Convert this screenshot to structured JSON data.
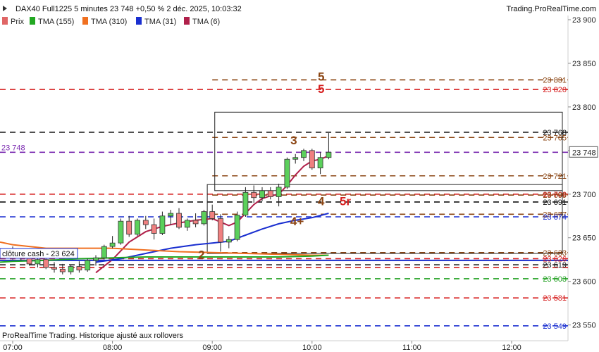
{
  "header": {
    "title": "DAX40 Full1225 5 minutes 23 748 +0,50 % 2 déc. 2025, 10:03:32",
    "brand": "Trading.ProRealTime.com"
  },
  "legend": [
    {
      "label": "Prix",
      "color": "#e06666"
    },
    {
      "label": "TMA (155)",
      "color": "#22a822"
    },
    {
      "label": "TMA (310)",
      "color": "#f07020"
    },
    {
      "label": "TMA (31)",
      "color": "#1a2fd0"
    },
    {
      "label": "TMA (6)",
      "color": "#b0204a"
    }
  ],
  "footer_note": "ProRealTime Trading. Historique ajusté aux rollovers",
  "cash_close_label": "clôture cash -  23 624",
  "current_price_label": "23 748",
  "current_price_left": "23 748",
  "chart_data": {
    "type": "candlestick",
    "ylim": [
      23540,
      23900
    ],
    "yticks": [
      "23 550",
      "23 600",
      "23 650",
      "23 700",
      "23 750",
      "23 800",
      "23 850",
      "23 900"
    ],
    "yticks_values": [
      23550,
      23600,
      23650,
      23700,
      23750,
      23800,
      23850,
      23900
    ],
    "xticks": [
      "07:00",
      "08:00",
      "09:00",
      "10:00",
      "11:00",
      "12:00"
    ],
    "candles": [
      {
        "t": "07:00",
        "o": 23630,
        "h": 23640,
        "l": 23625,
        "c": 23632
      },
      {
        "t": "07:05",
        "o": 23632,
        "h": 23635,
        "l": 23624,
        "c": 23627
      },
      {
        "t": "07:10",
        "o": 23627,
        "h": 23632,
        "l": 23618,
        "c": 23620
      },
      {
        "t": "07:15",
        "o": 23620,
        "h": 23628,
        "l": 23616,
        "c": 23625
      },
      {
        "t": "07:20",
        "o": 23625,
        "h": 23628,
        "l": 23614,
        "c": 23616
      },
      {
        "t": "07:25",
        "o": 23616,
        "h": 23622,
        "l": 23610,
        "c": 23614
      },
      {
        "t": "07:30",
        "o": 23614,
        "h": 23620,
        "l": 23608,
        "c": 23611
      },
      {
        "t": "07:35",
        "o": 23611,
        "h": 23619,
        "l": 23608,
        "c": 23617
      },
      {
        "t": "07:40",
        "o": 23617,
        "h": 23623,
        "l": 23610,
        "c": 23613
      },
      {
        "t": "07:45",
        "o": 23613,
        "h": 23626,
        "l": 23611,
        "c": 23624
      },
      {
        "t": "07:50",
        "o": 23624,
        "h": 23630,
        "l": 23618,
        "c": 23627
      },
      {
        "t": "07:55",
        "o": 23627,
        "h": 23642,
        "l": 23625,
        "c": 23640
      },
      {
        "t": "08:00",
        "o": 23640,
        "h": 23652,
        "l": 23638,
        "c": 23644
      },
      {
        "t": "08:05",
        "o": 23644,
        "h": 23672,
        "l": 23642,
        "c": 23669
      },
      {
        "t": "08:10",
        "o": 23669,
        "h": 23675,
        "l": 23651,
        "c": 23654
      },
      {
        "t": "08:15",
        "o": 23654,
        "h": 23672,
        "l": 23652,
        "c": 23670
      },
      {
        "t": "08:20",
        "o": 23670,
        "h": 23675,
        "l": 23660,
        "c": 23665
      },
      {
        "t": "08:25",
        "o": 23665,
        "h": 23672,
        "l": 23648,
        "c": 23655
      },
      {
        "t": "08:30",
        "o": 23655,
        "h": 23680,
        "l": 23653,
        "c": 23675
      },
      {
        "t": "08:35",
        "o": 23675,
        "h": 23682,
        "l": 23665,
        "c": 23678
      },
      {
        "t": "08:40",
        "o": 23678,
        "h": 23684,
        "l": 23660,
        "c": 23662
      },
      {
        "t": "08:45",
        "o": 23662,
        "h": 23672,
        "l": 23658,
        "c": 23670
      },
      {
        "t": "08:50",
        "o": 23670,
        "h": 23678,
        "l": 23662,
        "c": 23666
      },
      {
        "t": "08:55",
        "o": 23666,
        "h": 23682,
        "l": 23664,
        "c": 23680
      },
      {
        "t": "09:00",
        "o": 23680,
        "h": 23688,
        "l": 23670,
        "c": 23672
      },
      {
        "t": "09:05",
        "o": 23672,
        "h": 23677,
        "l": 23634,
        "c": 23645
      },
      {
        "t": "09:10",
        "o": 23645,
        "h": 23652,
        "l": 23638,
        "c": 23648
      },
      {
        "t": "09:15",
        "o": 23648,
        "h": 23680,
        "l": 23646,
        "c": 23676
      },
      {
        "t": "09:20",
        "o": 23676,
        "h": 23708,
        "l": 23674,
        "c": 23702
      },
      {
        "t": "09:25",
        "o": 23702,
        "h": 23710,
        "l": 23690,
        "c": 23696
      },
      {
        "t": "09:30",
        "o": 23696,
        "h": 23708,
        "l": 23692,
        "c": 23704
      },
      {
        "t": "09:35",
        "o": 23704,
        "h": 23708,
        "l": 23694,
        "c": 23697
      },
      {
        "t": "09:40",
        "o": 23697,
        "h": 23712,
        "l": 23686,
        "c": 23708
      },
      {
        "t": "09:45",
        "o": 23708,
        "h": 23742,
        "l": 23706,
        "c": 23740
      },
      {
        "t": "09:50",
        "o": 23740,
        "h": 23746,
        "l": 23735,
        "c": 23742
      },
      {
        "t": "09:55",
        "o": 23742,
        "h": 23752,
        "l": 23738,
        "c": 23750
      },
      {
        "t": "10:00",
        "o": 23750,
        "h": 23752,
        "l": 23728,
        "c": 23730
      },
      {
        "t": "10:05",
        "o": 23730,
        "h": 23748,
        "l": 23723,
        "c": 23742
      },
      {
        "t": "10:10",
        "o": 23742,
        "h": 23770,
        "l": 23740,
        "c": 23748
      }
    ],
    "series": [
      {
        "name": "TMA (6)",
        "color": "#b0204a",
        "points": [
          [
            10,
            23610
          ],
          [
            12,
            23625
          ],
          [
            14,
            23645
          ],
          [
            16,
            23657
          ],
          [
            18,
            23663
          ],
          [
            20,
            23667
          ],
          [
            22,
            23670
          ],
          [
            24,
            23672
          ],
          [
            25,
            23668
          ],
          [
            26,
            23664
          ],
          [
            27,
            23668
          ],
          [
            28,
            23678
          ],
          [
            29,
            23688
          ],
          [
            30,
            23695
          ],
          [
            31,
            23698
          ],
          [
            32,
            23700
          ],
          [
            33,
            23710
          ],
          [
            34,
            23722
          ],
          [
            35,
            23732
          ],
          [
            36,
            23738
          ],
          [
            37,
            23740
          ],
          [
            38,
            23744
          ]
        ]
      },
      {
        "name": "TMA (31)",
        "color": "#1a2fd0",
        "points": [
          [
            10,
            23622
          ],
          [
            13,
            23626
          ],
          [
            16,
            23632
          ],
          [
            19,
            23638
          ],
          [
            22,
            23642
          ],
          [
            24,
            23644
          ],
          [
            26,
            23646
          ],
          [
            28,
            23653
          ],
          [
            30,
            23660
          ],
          [
            32,
            23666
          ],
          [
            34,
            23670
          ],
          [
            36,
            23673
          ],
          [
            38,
            23678
          ]
        ]
      },
      {
        "name": "TMA (310)",
        "color": "#f07020",
        "points": [
          [
            -3,
            23645
          ],
          [
            0,
            23642
          ],
          [
            4,
            23638
          ],
          [
            8,
            23638
          ],
          [
            12,
            23638
          ],
          [
            16,
            23636
          ],
          [
            20,
            23634
          ],
          [
            24,
            23633
          ],
          [
            28,
            23632
          ],
          [
            32,
            23631
          ],
          [
            36,
            23630
          ],
          [
            38,
            23630
          ]
        ]
      },
      {
        "name": "TMA (155)",
        "color": "#22a822",
        "points": [
          [
            -3,
            23622
          ],
          [
            0,
            23623
          ],
          [
            4,
            23624
          ],
          [
            8,
            23626
          ],
          [
            12,
            23627
          ],
          [
            16,
            23628
          ],
          [
            20,
            23628
          ],
          [
            24,
            23628
          ],
          [
            28,
            23628
          ],
          [
            32,
            23628
          ],
          [
            36,
            23629
          ],
          [
            38,
            23630
          ]
        ]
      }
    ],
    "levels": [
      {
        "v": 23831,
        "color": "#8b4513",
        "label": "23 831",
        "from": 24
      },
      {
        "v": 23820,
        "color": "#d62020",
        "label": "23 820",
        "from": -3
      },
      {
        "v": 23771,
        "color": "#111111",
        "label": "23 768",
        "from": -3
      },
      {
        "v": 23765,
        "color": "#8b4513",
        "label": "23 765",
        "from": 24
      },
      {
        "v": 23748,
        "color": "#7a2ab0",
        "label": "",
        "from": -3
      },
      {
        "v": 23721,
        "color": "#8b4513",
        "label": "23 721",
        "from": 24
      },
      {
        "v": 23700,
        "color": "#d62020",
        "label": "23 700",
        "from": -3
      },
      {
        "v": 23699,
        "color": "#8b4513",
        "label": "23 699",
        "from": 24
      },
      {
        "v": 23691,
        "color": "#111111",
        "label": "23 691",
        "from": -3
      },
      {
        "v": 23677,
        "color": "#8b4513",
        "label": "23 677",
        "from": 24
      },
      {
        "v": 23674,
        "color": "#1a2fd0",
        "label": "23 674",
        "from": -3
      },
      {
        "v": 23633,
        "color": "#8b4513",
        "label": "23 633",
        "from": 24
      },
      {
        "v": 23626,
        "color": "#d62020",
        "label": "23 626",
        "from": -3
      },
      {
        "v": 23619,
        "color": "#111111",
        "label": "23 619",
        "from": -3
      },
      {
        "v": 23616,
        "color": "#d62020",
        "label": "",
        "from": -3
      },
      {
        "v": 23603,
        "color": "#22a022",
        "label": "23 603",
        "from": -3
      },
      {
        "v": 23581,
        "color": "#d62020",
        "label": "23 581",
        "from": -3
      },
      {
        "v": 23549,
        "color": "#1a2fd0",
        "label": "23 549",
        "from": -3
      }
    ],
    "cash_close": {
      "v": 23624,
      "color": "#1a2fd0"
    },
    "boxes": [
      {
        "from": 24.3,
        "to": 73.4,
        "top": 23794,
        "bottom": 23704
      },
      {
        "from": 23.4,
        "to": 73.4,
        "top": 23711,
        "bottom": 23632
      }
    ],
    "wave_labels": [
      {
        "text": "5",
        "at": 37.1,
        "v": 23835,
        "color": "#8b4513"
      },
      {
        "text": "5",
        "at": 37.1,
        "v": 23821,
        "color": "#d62020"
      },
      {
        "text": "3",
        "at": 33.8,
        "v": 23762,
        "color": "#8b4513"
      },
      {
        "text": "4",
        "at": 37.1,
        "v": 23692,
        "color": "#8b4513"
      },
      {
        "text": "5r",
        "at": 40.0,
        "v": 23692,
        "color": "#d62020"
      },
      {
        "text": "4+",
        "at": 34.2,
        "v": 23669,
        "color": "#8b4513"
      },
      {
        "text": "2",
        "at": 22.7,
        "v": 23631,
        "color": "#8b4513"
      }
    ]
  }
}
